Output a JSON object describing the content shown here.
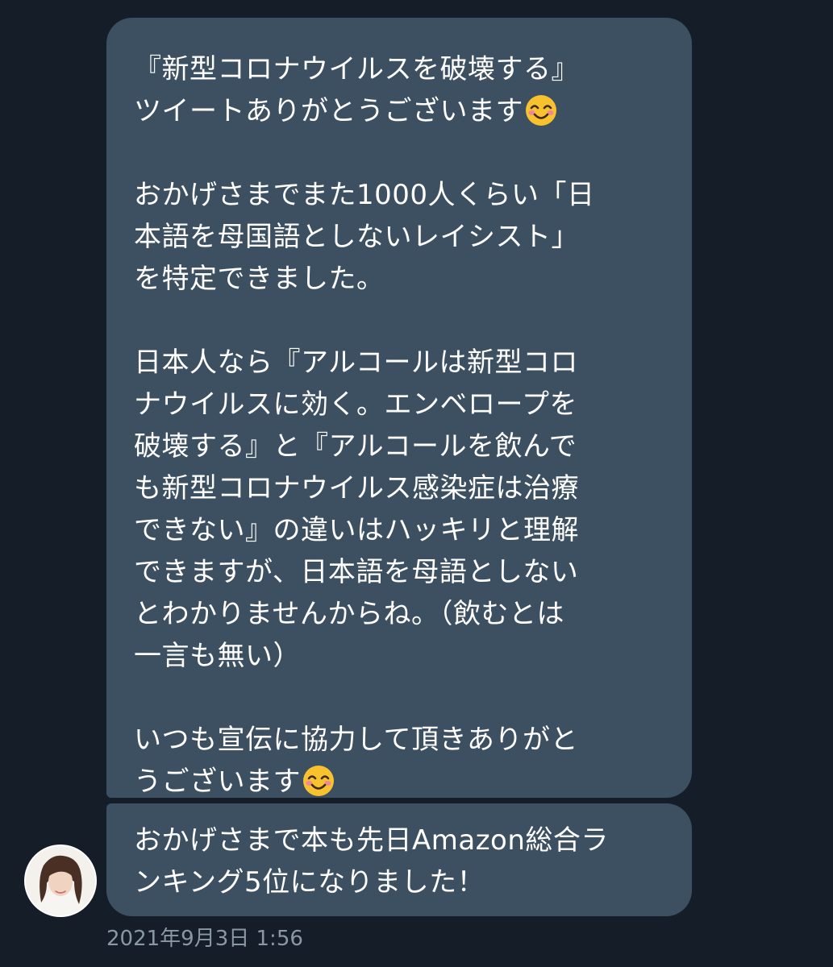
{
  "messages": [
    {
      "lines": [
        "『新型コロナウイルスを破壊する』",
        "ツイートありがとうございます",
        "",
        "おかげさまでまた1000人くらい「日",
        "本語を母国語としないレイシスト」",
        "を特定できました。",
        "",
        "日本人なら『アルコールは新型コロ",
        "ナウイルスに効く。エンベロープを",
        "破壊する』と『アルコールを飲んで",
        "も新型コロナウイルス感染症は治療",
        "できない』の違いはハッキリと理解",
        "できますが、日本語を母語としない",
        "とわかりませんからね。（飲むとは",
        "一言も無い）",
        "",
        "いつも宣伝に協力して頂きありがと",
        "うございます"
      ],
      "emoji": "smiling-face-with-smiling-eyes"
    },
    {
      "lines": [
        "おかげさまで本も先日Amazon総合ラ",
        "ンキング5位になりました！"
      ]
    }
  ],
  "timestamp": "2021年9月3日 1:56",
  "colors": {
    "background": "#151d28",
    "bubble": "#3d5062",
    "text": "#ffffff",
    "timestamp": "#8a97a5"
  }
}
